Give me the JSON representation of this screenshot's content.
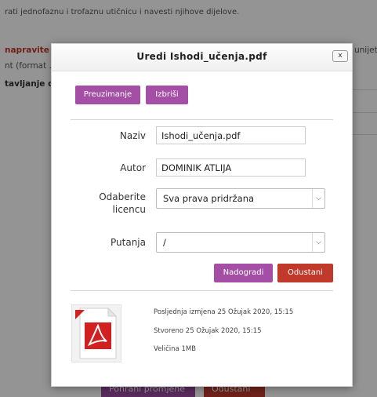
{
  "background": {
    "line1": "rati jednofaznu i trofaznu utičnicu i navesti njihove dijelove.",
    "warn_start": "napravite",
    "warn_tail": "unijet",
    "format_text": "nt (format .",
    "bold_text": "tavljanje d",
    "save_label": "Pohrani promjene",
    "cancel_label": "Odustani"
  },
  "modal": {
    "title": "Uredi Ishodi_učenja.pdf",
    "close_label": "x",
    "download_label": "Preuzimanje",
    "delete_label": "Izbriši",
    "name_label": "Naziv",
    "name_value": "Ishodi_učenja.pdf",
    "author_label": "Autor",
    "author_value": "DOMINIK ATLIJA",
    "license_label_line1": "Odaberite",
    "license_label_line2": "licencu",
    "license_value": "Sva prava pridržana",
    "path_label": "Putanja",
    "path_value": "/",
    "update_label": "Nadogradi",
    "cancel_label": "Odustani",
    "last_modified": "Posljednja izmjena  25 Ožujak 2020, 15:15",
    "created": "Stvoreno  25 Ožujak 2020, 15:15",
    "size": "Veličina  1MB"
  },
  "colors": {
    "accent_purple": "#a44ea5",
    "danger_red": "#c0392b"
  },
  "icons": {
    "file": "pdf-file-icon",
    "dropdown": "chevron-down-icon"
  }
}
